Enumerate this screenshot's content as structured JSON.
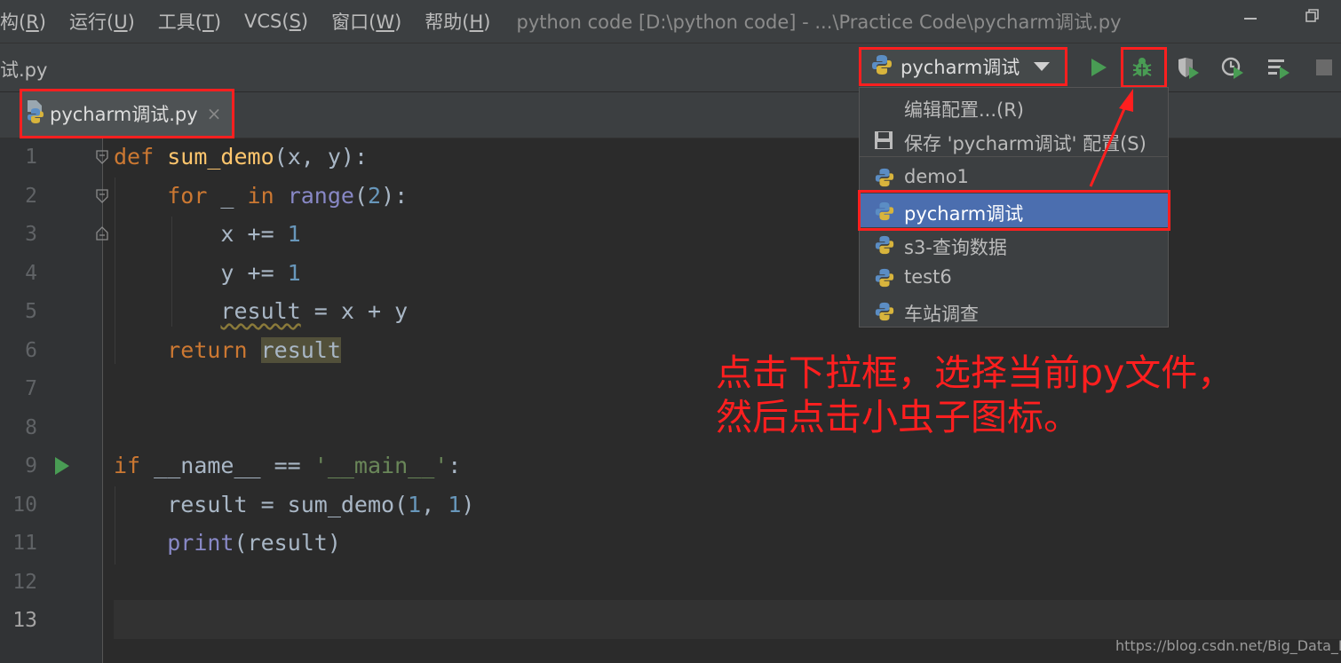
{
  "menu": {
    "items": [
      {
        "label": "构(",
        "key": "R",
        "end": ")"
      },
      {
        "label": "运行(",
        "key": "U",
        "end": ")"
      },
      {
        "label": "工具(",
        "key": "T",
        "end": ")"
      },
      {
        "label": "VCS(",
        "key": "S",
        "end": ")"
      },
      {
        "label": "窗口(",
        "key": "W",
        "end": ")"
      },
      {
        "label": "帮助(",
        "key": "H",
        "end": ")"
      }
    ],
    "window_title": "python code [D:\\python code] - ...\\Practice Code\\pycharm调试.py"
  },
  "navbar": {
    "breadcrumb": "试.py",
    "run_config_label": "pycharm调试"
  },
  "tab": {
    "label": "pycharm调试.py",
    "close": "×"
  },
  "editor": {
    "line_numbers": [
      "1",
      "2",
      "3",
      "4",
      "5",
      "6",
      "7",
      "8",
      "9",
      "10",
      "11",
      "12",
      "13"
    ],
    "active_line": "13"
  },
  "dropdown": {
    "edit_config": "编辑配置...(R)",
    "save_config": "保存 'pycharm调试' 配置(S)",
    "configs": [
      "demo1",
      "pycharm调试",
      "s3-查询数据",
      "test6",
      "车站调查"
    ],
    "selected": "pycharm调试"
  },
  "annotation": {
    "line1": "点击下拉框，选择当前py文件，",
    "line2": "然后点击小虫子图标。"
  },
  "watermark": "https://blog.csdn.net/Big_Data_Kai",
  "colors": {
    "highlight_red": "#ff1f1f",
    "selection_blue": "#4b6eaf",
    "run_green": "#499c54",
    "keyword_orange": "#cc7832",
    "function_yellow": "#ffc66d",
    "number_blue": "#6897bb",
    "string_green": "#6a8759",
    "builtin_purple": "#8888c6"
  },
  "icons": [
    "python-file-icon",
    "python-config-icon",
    "run-icon",
    "debug-bug-icon",
    "coverage-icon",
    "profile-icon",
    "concurrency-icon",
    "stop-icon",
    "save-floppy-icon",
    "fold-icon",
    "gutter-run-icon",
    "minimize-icon",
    "restore-icon"
  ]
}
